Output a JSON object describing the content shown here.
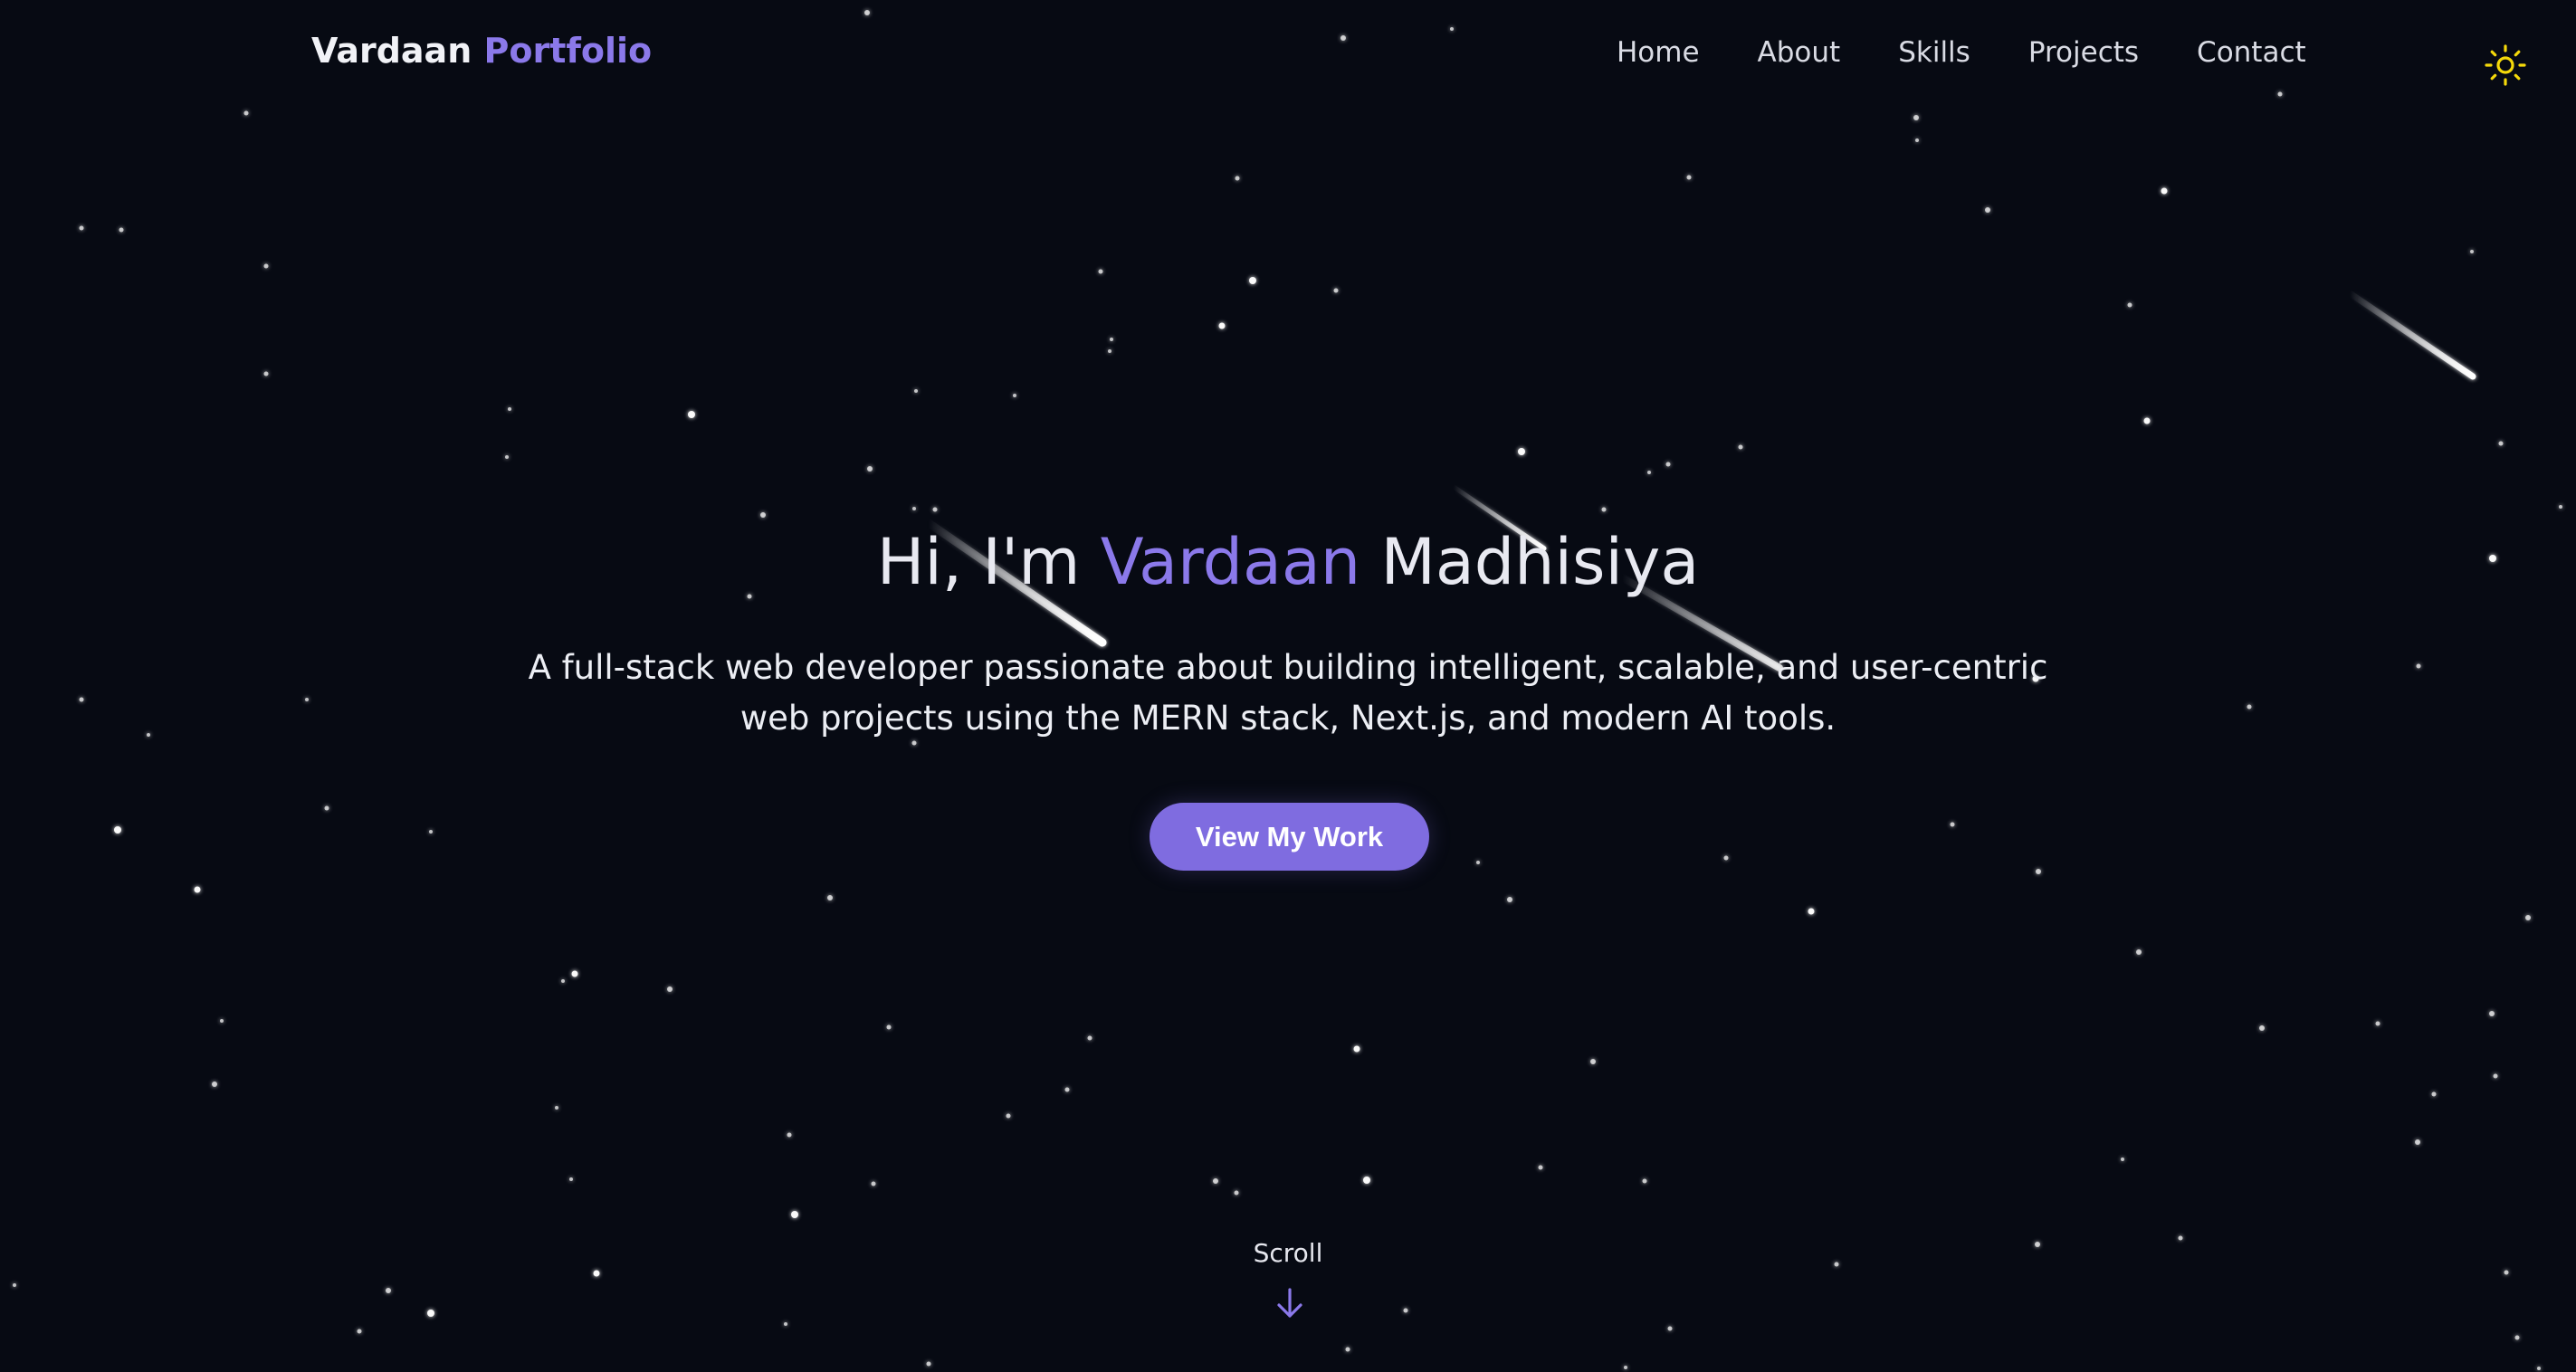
{
  "navbar": {
    "brand_first": "Vardaan",
    "brand_second": "Portfolio",
    "links": [
      "Home",
      "About",
      "Skills",
      "Projects",
      "Contact"
    ],
    "theme_icon": "sun-icon"
  },
  "hero": {
    "greeting": "Hi, I'm",
    "first_name": "Vardaan",
    "last_name": "Madhisiya",
    "subtitle": "A full-stack web developer passionate about building intelligent, scalable, and user-centric web projects using the MERN stack, Next.js, and modern AI tools.",
    "cta_label": "View My Work"
  },
  "scroll": {
    "label": "Scroll",
    "icon": "arrow-down-icon"
  },
  "colors": {
    "background": "#070a13",
    "accent": "#8b79ea",
    "button": "#7f6ce0",
    "sun": "#f5d90a"
  }
}
